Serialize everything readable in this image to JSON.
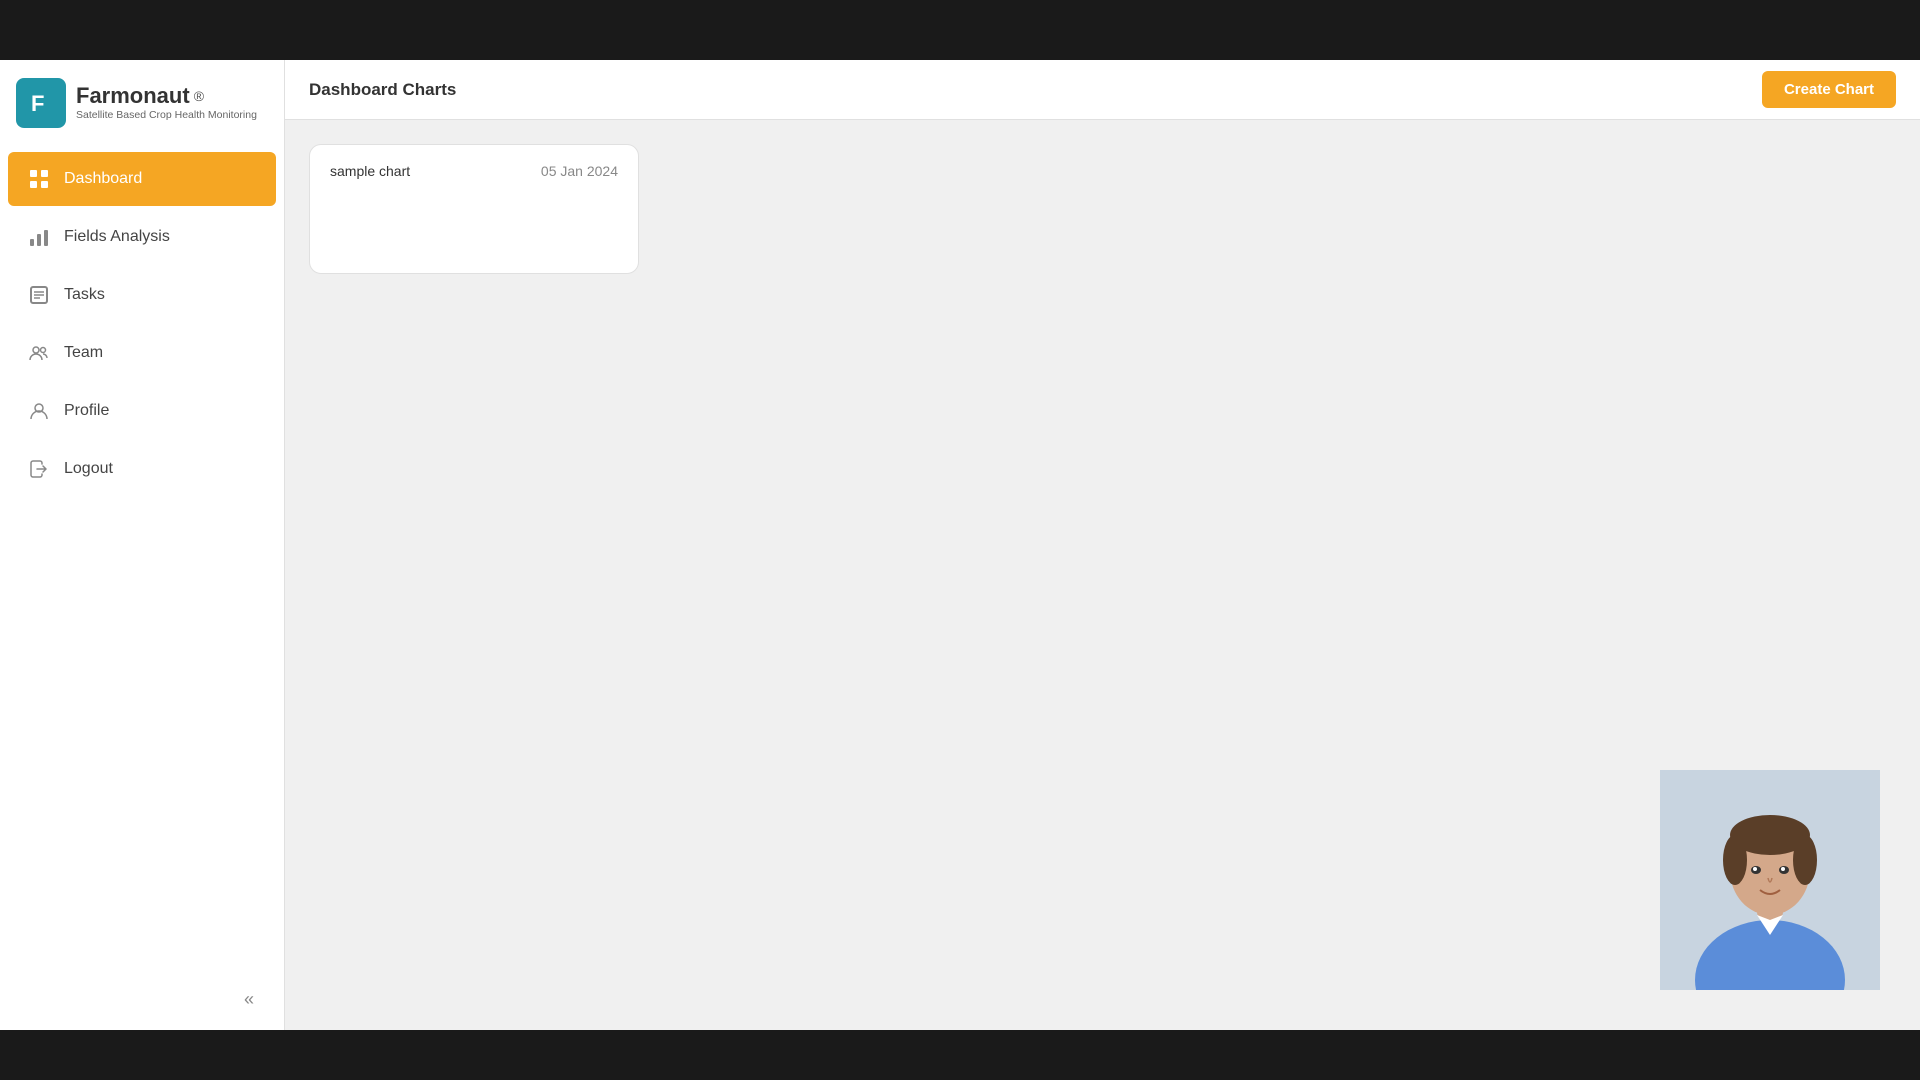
{
  "app": {
    "name": "Farmonaut",
    "registered_symbol": "®",
    "subtitle": "Satellite Based Crop Health Monitoring"
  },
  "sidebar": {
    "items": [
      {
        "id": "dashboard",
        "label": "Dashboard",
        "icon": "dashboard-icon",
        "active": true
      },
      {
        "id": "fields-analysis",
        "label": "Fields Analysis",
        "icon": "fields-analysis-icon",
        "active": false
      },
      {
        "id": "tasks",
        "label": "Tasks",
        "icon": "tasks-icon",
        "active": false
      },
      {
        "id": "team",
        "label": "Team",
        "icon": "team-icon",
        "active": false
      },
      {
        "id": "profile",
        "label": "Profile",
        "icon": "profile-icon",
        "active": false
      },
      {
        "id": "logout",
        "label": "Logout",
        "icon": "logout-icon",
        "active": false
      }
    ],
    "collapse_button": "«"
  },
  "header": {
    "title": "Dashboard Charts",
    "create_button_label": "Create Chart"
  },
  "charts": [
    {
      "id": "chart-1",
      "title": "sample chart",
      "date": "05 Jan 2024"
    }
  ]
}
